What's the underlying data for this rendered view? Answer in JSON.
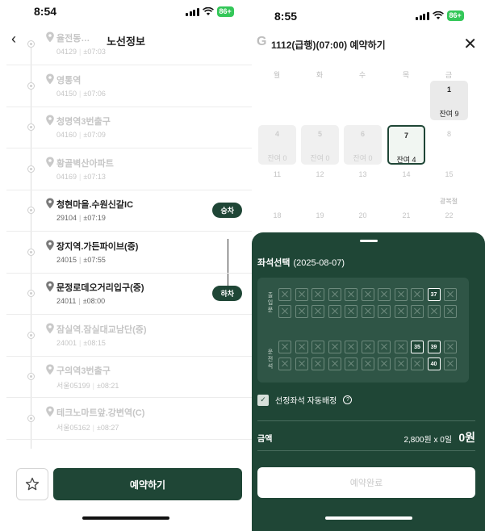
{
  "left": {
    "status_time": "8:54",
    "battery": "86+",
    "title": "노선정보",
    "stops": [
      {
        "name": "율전동…",
        "code": "04129",
        "time": "±07:03",
        "active": false
      },
      {
        "name": "영통역",
        "code": "04150",
        "time": "±07:06",
        "active": false
      },
      {
        "name": "청명역3번출구",
        "code": "04160",
        "time": "±07:09",
        "active": false
      },
      {
        "name": "황골벽산아파트",
        "code": "04169",
        "time": "±07:13",
        "active": false
      },
      {
        "name": "청현마을.수원신갈IC",
        "code": "29104",
        "time": "±07:19",
        "active": true,
        "tag": "승차"
      },
      {
        "name": "장지역.가든파이브(중)",
        "code": "24015",
        "time": "±07:55",
        "active": true
      },
      {
        "name": "문정로데오거리입구(중)",
        "code": "24011",
        "time": "±08:00",
        "active": true,
        "tag": "하차"
      },
      {
        "name": "잠실역.잠실대교남단(중)",
        "code": "24001",
        "time": "±08:15",
        "active": false
      },
      {
        "name": "구의역3번출구",
        "code": "서울05199",
        "time": "±08:21",
        "active": false
      },
      {
        "name": "테크노마트앞.강변역(C)",
        "code": "서울05162",
        "time": "±08:27",
        "active": false
      }
    ],
    "reserve_label": "예약하기",
    "icons": {
      "back": "chevron-left-icon",
      "favorite": "star-icon",
      "stop": "map-pin-icon"
    }
  },
  "right": {
    "status_time": "8:55",
    "battery": "86+",
    "logo": "G",
    "title": "1112(급행)(07:00) 예약하기",
    "weekdays": [
      "월",
      "화",
      "수",
      "목",
      "금"
    ],
    "calendar": [
      {
        "day": "1",
        "seats": "잔여 9",
        "state": "avail"
      },
      {
        "day": "4",
        "seats": "잔여 0",
        "state": "past"
      },
      {
        "day": "5",
        "seats": "잔여 0",
        "state": "past"
      },
      {
        "day": "6",
        "seats": "잔여 0",
        "state": "past"
      },
      {
        "day": "7",
        "seats": "잔여 4",
        "state": "sel"
      },
      {
        "day": "8",
        "seats": "",
        "state": "plain"
      },
      {
        "day": "11",
        "seats": "",
        "state": "plain"
      },
      {
        "day": "12",
        "seats": "",
        "state": "plain"
      },
      {
        "day": "13",
        "seats": "",
        "state": "plain"
      },
      {
        "day": "14",
        "seats": "",
        "state": "plain"
      },
      {
        "day": "15",
        "seats": "",
        "state": "plain"
      },
      {
        "day": "18",
        "seats": "",
        "state": "plain"
      },
      {
        "day": "19",
        "seats": "",
        "state": "plain"
      },
      {
        "day": "20",
        "seats": "",
        "state": "plain"
      },
      {
        "day": "21",
        "seats": "",
        "state": "plain"
      },
      {
        "day": "22",
        "seats": "",
        "state": "plain"
      }
    ],
    "holiday_label": "광복절",
    "seat_section_label": "좌석선택",
    "seat_date": "(2025-08-07)",
    "door_label": "출입문",
    "driver_label": "운전석",
    "open_seats": [
      "37",
      "35",
      "39",
      "40"
    ],
    "auto_assign_label": "선정좌석 자동배정",
    "amount_label": "금액",
    "amount_calc": "2,800원 x 0일",
    "amount_total": "0원",
    "confirm_label": "예약완료"
  }
}
